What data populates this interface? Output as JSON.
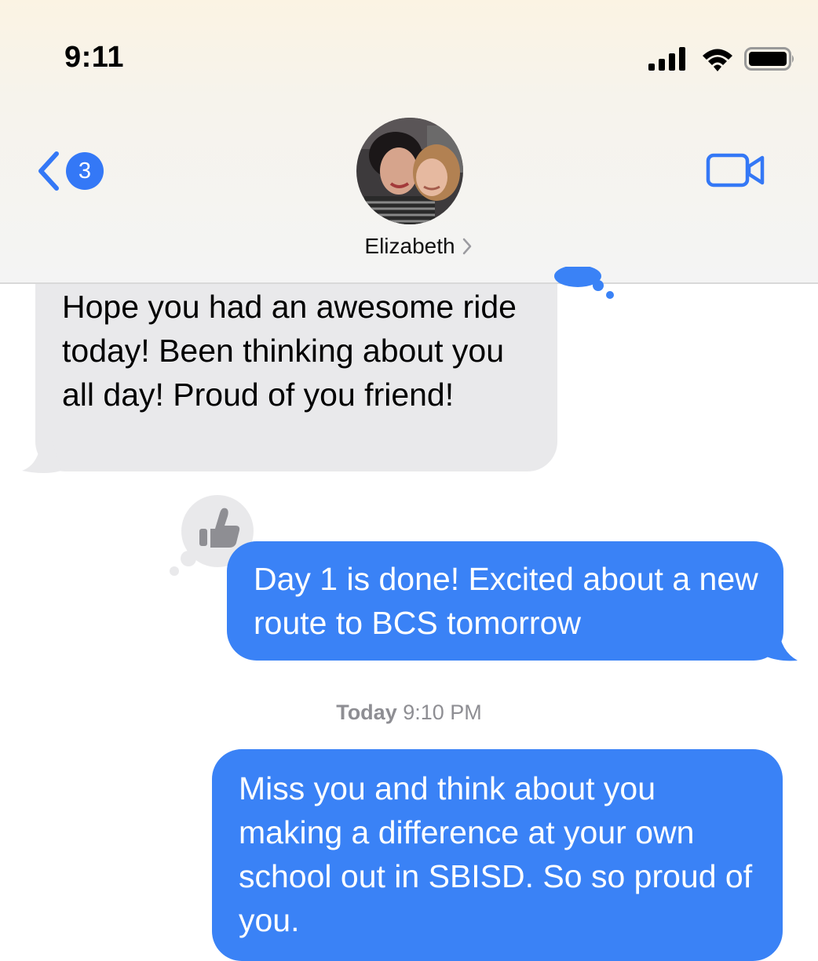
{
  "status_bar": {
    "time": "9:11",
    "signal_icon": "cellular-signal-icon",
    "wifi_icon": "wifi-icon",
    "battery_icon": "battery-icon"
  },
  "header": {
    "back_badge_count": "3",
    "contact_name": "Elizabeth",
    "video_icon": "video-camera-icon",
    "accent_color": "#3478f6"
  },
  "messages": [
    {
      "direction": "incoming",
      "text": "Hope you had an awesome ride today!  Been thinking about you all day!   Proud of you friend!"
    },
    {
      "direction": "outgoing",
      "text": "Day 1 is done! Excited about a new route to BCS tomorrow",
      "tapback": "thumbs-up-icon"
    },
    {
      "direction": "outgoing",
      "text": "Miss you and think about you making a difference at your own school out in SBISD. So so proud of you."
    }
  ],
  "timestamp": {
    "day": "Today",
    "time": "9:10 PM"
  }
}
